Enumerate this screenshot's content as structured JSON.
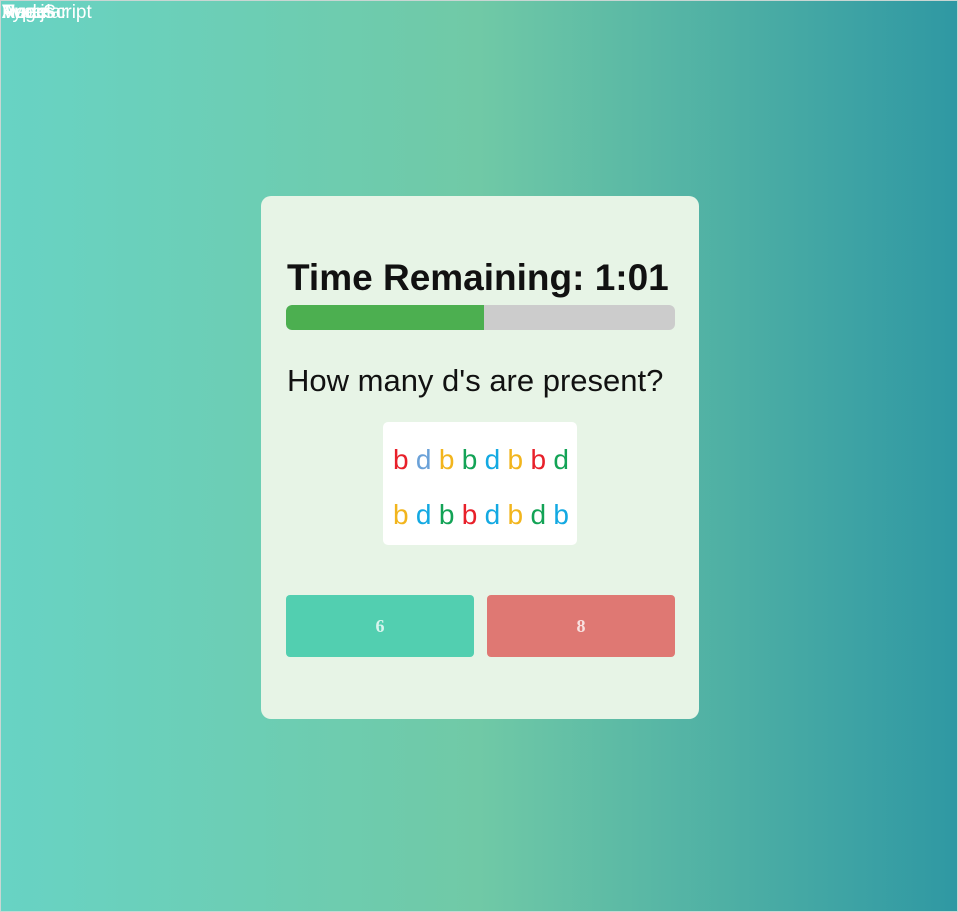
{
  "header_overlap_labels": [
    "Vue.js",
    "React",
    "Angular",
    "Node",
    "TypeScript"
  ],
  "timer": {
    "label": "Time Remaining: 1:01",
    "progress_fraction": 0.51,
    "fill_color": "#4caf50",
    "track_color": "#cccccc"
  },
  "question": "How many d's are present?",
  "letters": {
    "row1": [
      {
        "char": "b",
        "color": "#e8202a"
      },
      {
        "char": "d",
        "color": "#6aa1d8"
      },
      {
        "char": "b",
        "color": "#f2b51d"
      },
      {
        "char": "b",
        "color": "#13a356"
      },
      {
        "char": "d",
        "color": "#13a9e2"
      },
      {
        "char": "b",
        "color": "#f2b51d"
      },
      {
        "char": "b",
        "color": "#e8202a"
      },
      {
        "char": "d",
        "color": "#13a356"
      }
    ],
    "row2": [
      {
        "char": "b",
        "color": "#f2b51d"
      },
      {
        "char": "d",
        "color": "#13a9e2"
      },
      {
        "char": "b",
        "color": "#13a356"
      },
      {
        "char": "b",
        "color": "#e8202a"
      },
      {
        "char": "d",
        "color": "#13a9e2"
      },
      {
        "char": "b",
        "color": "#f2b51d"
      },
      {
        "char": "d",
        "color": "#13a356"
      },
      {
        "char": "b",
        "color": "#13a9e2"
      }
    ]
  },
  "answers": {
    "left_label": "6",
    "right_label": "8",
    "left_color": "#52cfb0",
    "right_color": "#df7873"
  }
}
